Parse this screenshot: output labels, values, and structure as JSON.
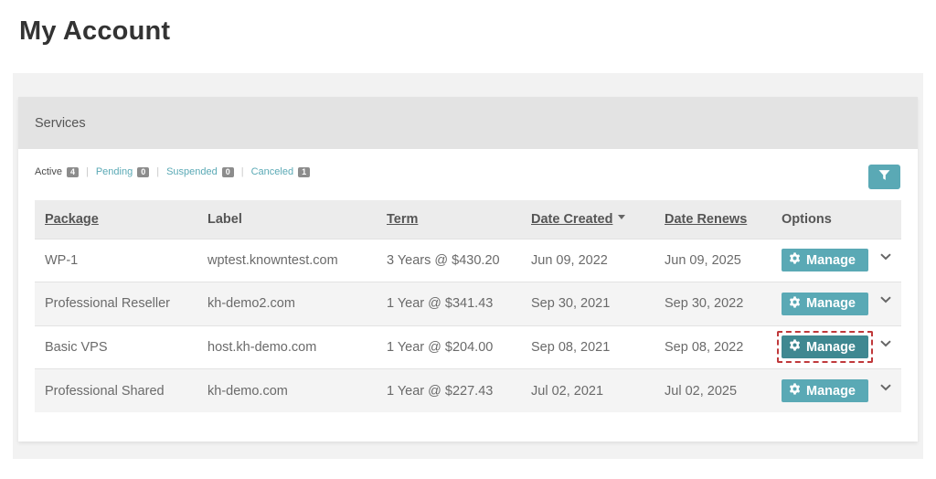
{
  "page": {
    "title": "My Account"
  },
  "panel": {
    "title": "Services"
  },
  "status_filters": [
    {
      "label": "Active",
      "count": "4",
      "is_link": false
    },
    {
      "label": "Pending",
      "count": "0",
      "is_link": true
    },
    {
      "label": "Suspended",
      "count": "0",
      "is_link": true
    },
    {
      "label": "Canceled",
      "count": "1",
      "is_link": true
    }
  ],
  "filter_button": {
    "icon": "filter-icon"
  },
  "table": {
    "headers": {
      "package": "Package",
      "label": "Label",
      "term": "Term",
      "date_created": "Date Created",
      "date_renews": "Date Renews",
      "options": "Options"
    },
    "sort": {
      "column": "date_created",
      "direction": "desc"
    },
    "rows": [
      {
        "package": "WP-1",
        "label": "wptest.knowntest.com",
        "term": "3 Years @ $430.20",
        "date_created": "Jun 09, 2022",
        "date_renews": "Jun 09, 2025",
        "button": "Manage",
        "highlighted": false
      },
      {
        "package": "Professional Reseller",
        "label": "kh-demo2.com",
        "term": "1 Year @ $341.43",
        "date_created": "Sep 30, 2021",
        "date_renews": "Sep 30, 2022",
        "button": "Manage",
        "highlighted": false
      },
      {
        "package": "Basic VPS",
        "label": "host.kh-demo.com",
        "term": "1 Year @ $204.00",
        "date_created": "Sep 08, 2021",
        "date_renews": "Sep 08, 2022",
        "button": "Manage",
        "highlighted": true
      },
      {
        "package": "Professional Shared",
        "label": "kh-demo.com",
        "term": "1 Year @ $227.43",
        "date_created": "Jul 02, 2021",
        "date_renews": "Jul 02, 2025",
        "button": "Manage",
        "highlighted": false
      }
    ]
  },
  "colors": {
    "accent": "#5aa9b5",
    "accent_active": "#3f8891",
    "highlight_dash": "#c0393b",
    "badge": "#8c8c8c"
  }
}
